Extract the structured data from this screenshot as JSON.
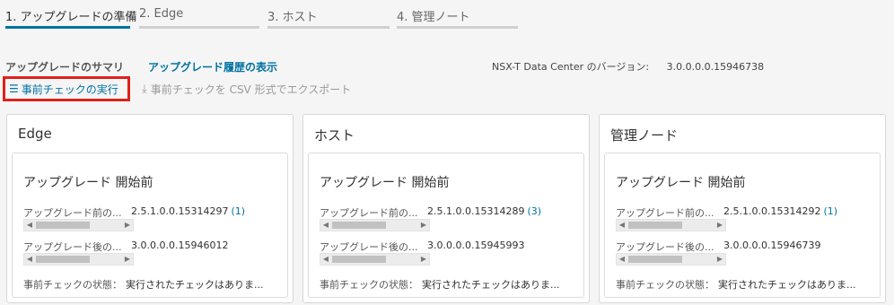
{
  "steps": [
    {
      "label": "1. アップグレードの準備",
      "active": true
    },
    {
      "label": "2. Edge",
      "active": false
    },
    {
      "label": "3. ホスト",
      "active": false
    },
    {
      "label": "4. 管理ノート",
      "active": false
    }
  ],
  "summary": {
    "title": "アップグレードのサマリ",
    "history_link": "アップグレード履歴の表示",
    "version_label": "NSX-T Data Center のバージョン:",
    "version_value": "3.0.0.0.0.15946738"
  },
  "actions": {
    "run_precheck": "事前チェックの実行",
    "run_precheck_icon": "checklist-icon",
    "export_csv": "事前チェックを CSV 形式でエクスポート",
    "export_icon": "download-icon"
  },
  "cards": [
    {
      "title": "Edge",
      "status": "アップグレード 開始前",
      "pre_label": "アップグレード前の...",
      "pre_value": "2.5.1.0.0.15314297",
      "pre_count": "(1)",
      "post_label": "アップグレード後の...",
      "post_value": "3.0.0.0.0.15946012",
      "precheck_label": "事前チェックの状態：",
      "precheck_value": "実行されたチェックはありま..."
    },
    {
      "title": "ホスト",
      "status": "アップグレード 開始前",
      "pre_label": "アップグレード前の...",
      "pre_value": "2.5.1.0.0.15314289",
      "pre_count": "(3)",
      "post_label": "アップグレード後の...",
      "post_value": "3.0.0.0.0.15945993",
      "precheck_label": "事前チェックの状態：",
      "precheck_value": "実行されたチェックはありま..."
    },
    {
      "title": "管理ノード",
      "status": "アップグレード 開始前",
      "pre_label": "アップグレード前の...",
      "pre_value": "2.5.1.0.0.15314292",
      "pre_count": "(1)",
      "post_label": "アップグレード後の...",
      "post_value": "3.0.0.0.0.15946739",
      "precheck_label": "事前チェックの状態：",
      "precheck_value": "実行されたチェックはありま..."
    }
  ],
  "colors": {
    "accent": "#0072a3",
    "highlight_border": "#e0201b"
  }
}
